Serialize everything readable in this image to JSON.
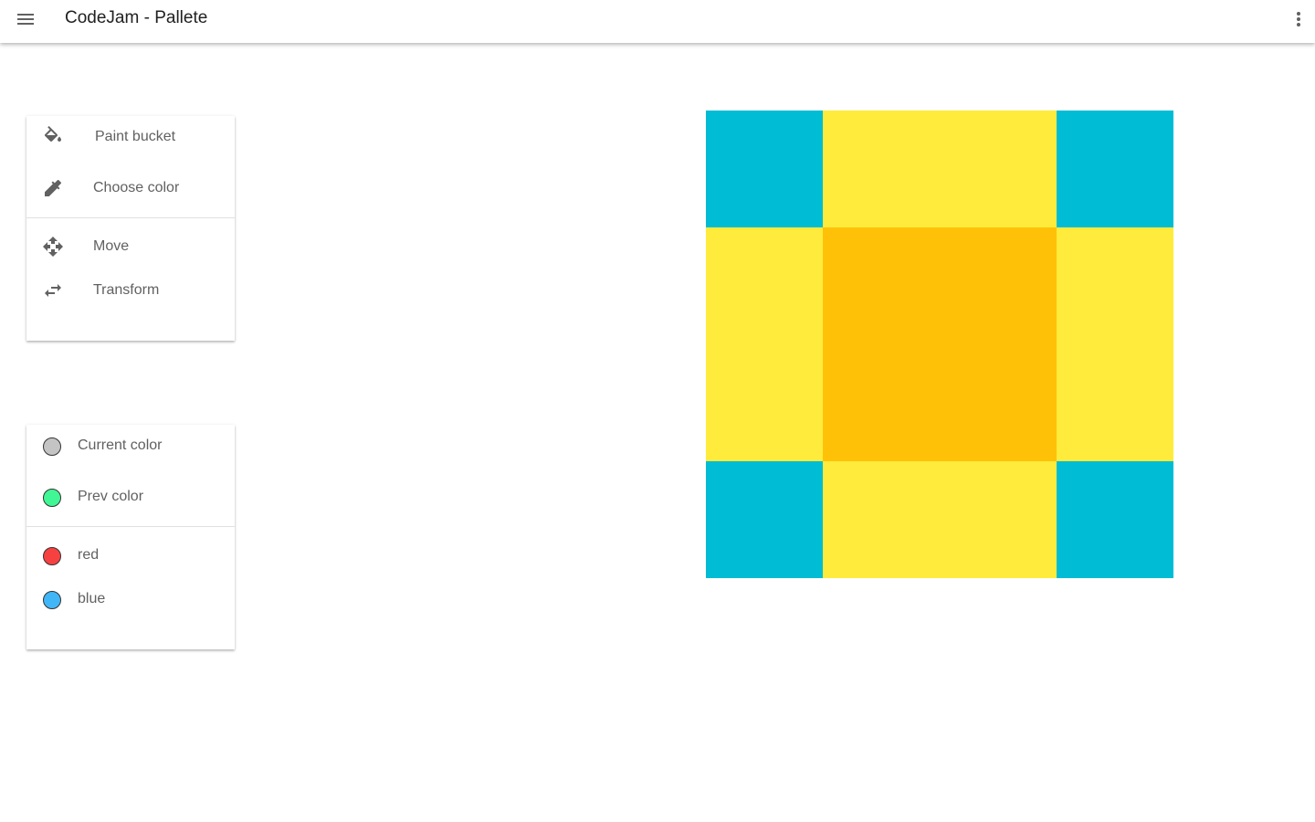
{
  "app": {
    "title": "CodeJam - Pallete",
    "menu_icon": "menu-icon",
    "more_icon": "more-vert-icon"
  },
  "tools": {
    "items": [
      {
        "label": "Paint bucket",
        "icon": "paint-bucket-icon"
      },
      {
        "label": "Choose color",
        "icon": "eyedropper-icon"
      },
      {
        "label": "Move",
        "icon": "move-icon"
      },
      {
        "label": "Transform",
        "icon": "transform-icon"
      }
    ]
  },
  "colors": {
    "current": {
      "label": "Current color",
      "color": "#c4c4c4"
    },
    "prev": {
      "label": "Prev color",
      "color": "#41f795"
    },
    "presets": [
      {
        "label": "red",
        "color": "#f74141"
      },
      {
        "label": "blue",
        "color": "#41b6f7"
      }
    ]
  },
  "canvas": {
    "cells": [
      {
        "name": "top-left",
        "color": "#00bcd4"
      },
      {
        "name": "top-center",
        "color": "#ffeb3b"
      },
      {
        "name": "top-right",
        "color": "#00bcd4"
      },
      {
        "name": "middle-left",
        "color": "#ffeb3b"
      },
      {
        "name": "center",
        "color": "#ffc107"
      },
      {
        "name": "middle-right",
        "color": "#ffeb3b"
      },
      {
        "name": "bottom-left",
        "color": "#00bcd4"
      },
      {
        "name": "bottom-center",
        "color": "#ffeb3b"
      },
      {
        "name": "bottom-right",
        "color": "#00bcd4"
      }
    ]
  }
}
